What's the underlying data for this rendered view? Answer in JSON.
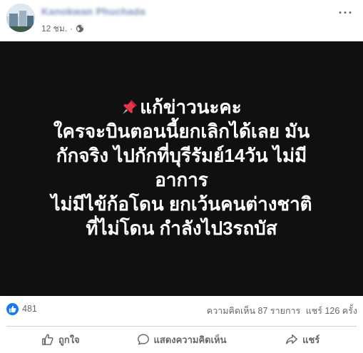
{
  "header": {
    "author_name": "Kanokwan Phuchada",
    "timestamp": "12 ชม.",
    "separator": "·",
    "privacy_icon": "globe-icon",
    "more_icon": "more-dots-icon"
  },
  "post": {
    "background_color": "#101010",
    "text_color": "#ffffff",
    "lines": [
      "แก้ข่าวนะคะ",
      "ใครจะบินตอนนี้ยกเลิกได้เลย มัน",
      "กักจริง ไปกักที่บุรีรัมย์14วัน ไม่มี",
      "อาการ",
      "ไม่มีไข้ก้อโดน ยกเว้นคนต่างชาติ",
      "ที่ไม่โดน กำลังไป3รถบัส"
    ],
    "leading_icon": "pushpin-icon"
  },
  "stats": {
    "reaction_icon": "like-reaction-icon",
    "reaction_count": "481",
    "comments": "ความคิดเห็น 87 รายการ",
    "shares": "แชร์ 126 ครั้ง"
  },
  "actions": {
    "like_label": "ถูกใจ",
    "comment_label": "แสดงความคิดเห็น",
    "share_label": "แชร์"
  },
  "colors": {
    "accent": "#1877f2",
    "secondary_text": "#65676b",
    "divider": "#ced0d4"
  }
}
